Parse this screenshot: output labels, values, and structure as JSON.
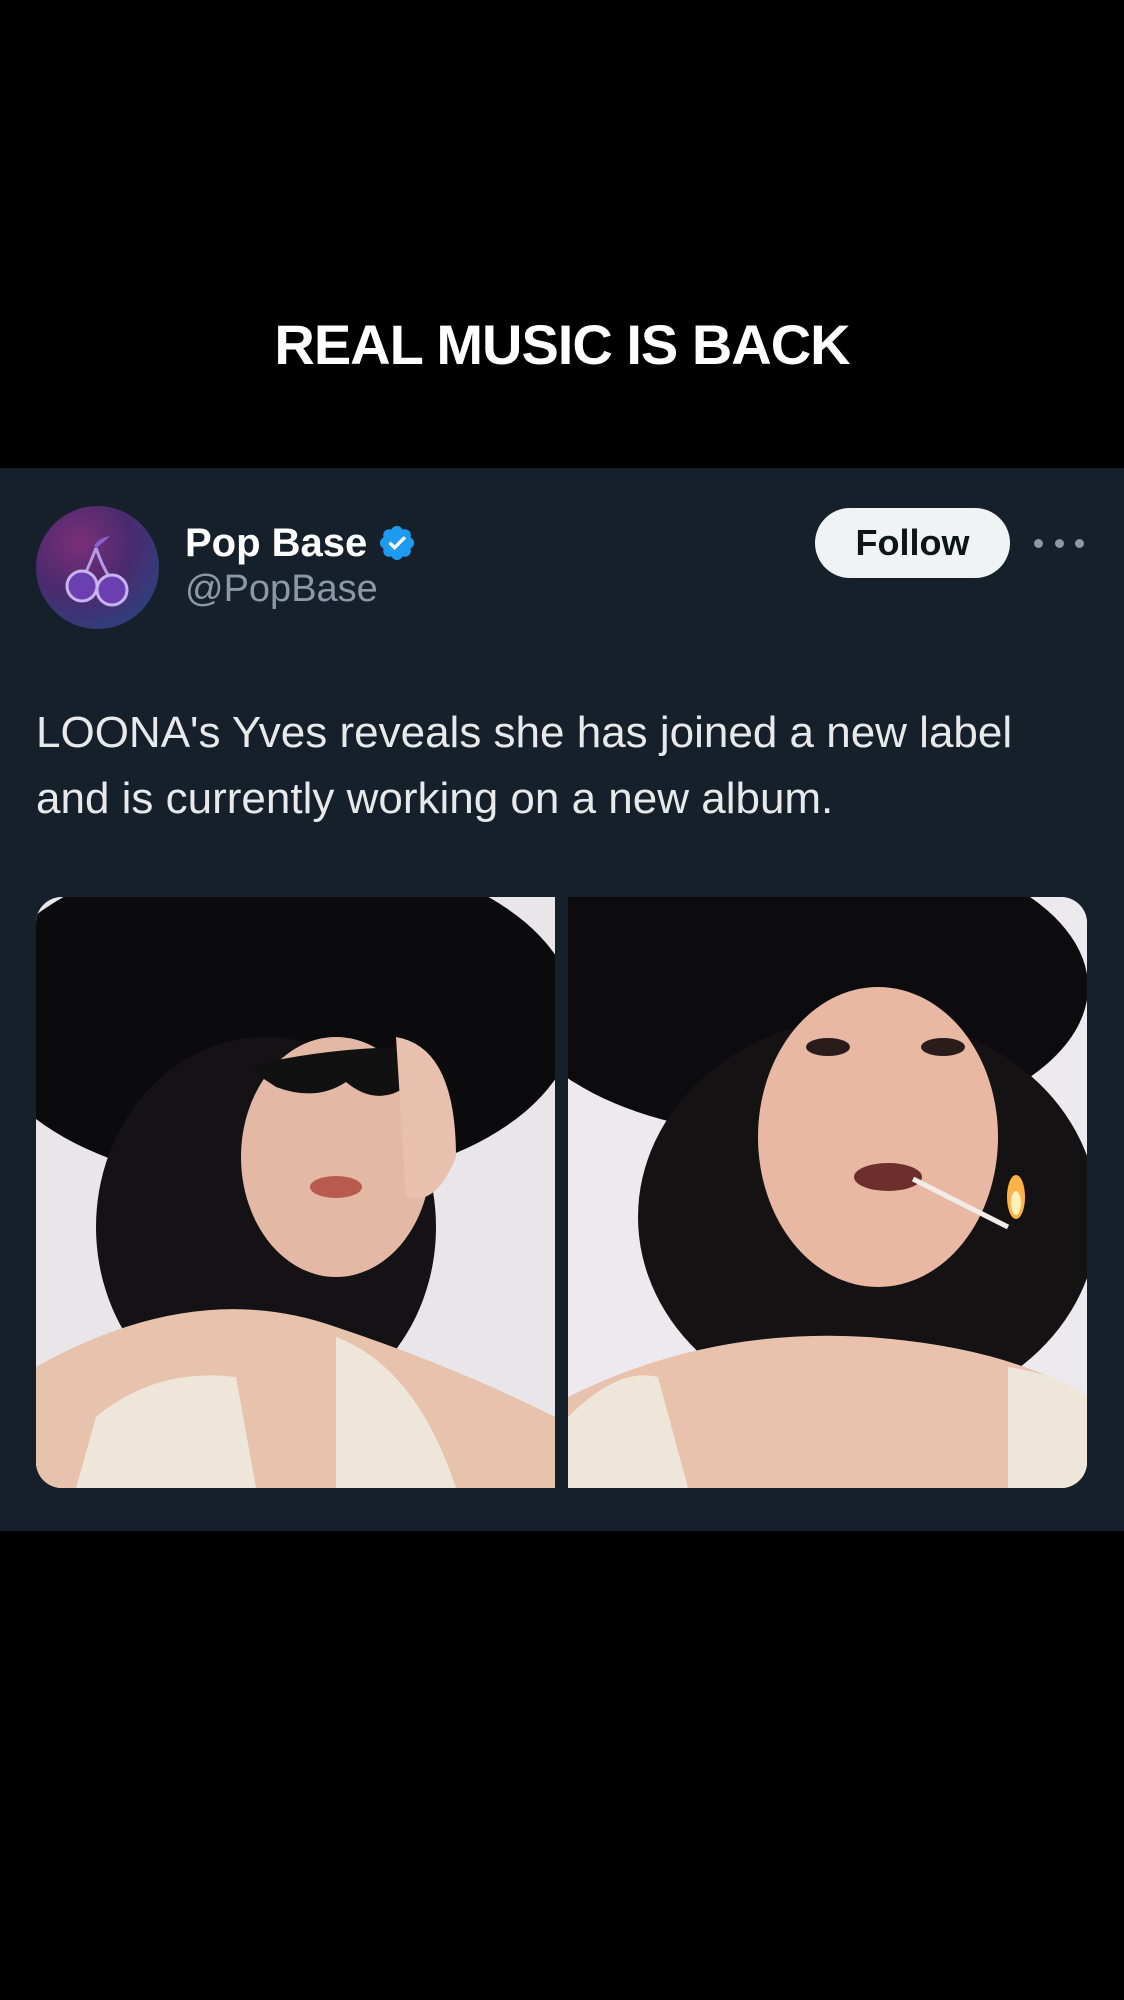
{
  "video": {
    "caption": "REAL MUSIC IS BACK"
  },
  "tweet": {
    "author": {
      "name": "Pop Base",
      "handle": "@PopBase",
      "verified": true,
      "avatar_icon": "cherry-icon"
    },
    "follow_label": "Follow",
    "more_icon": "more-options-icon",
    "text": "LOONA's Yves reveals she has joined a new label and is currently working on a new album.",
    "media": [
      {
        "subject": "woman in black hat and sunglasses"
      },
      {
        "subject": "woman in black hat holding a lit match"
      }
    ]
  },
  "colors": {
    "background": "#000000",
    "card": "#16202b",
    "verified": "#1d9bf0",
    "follow_bg": "#eff3f4",
    "secondary_text": "#8b98a5"
  }
}
